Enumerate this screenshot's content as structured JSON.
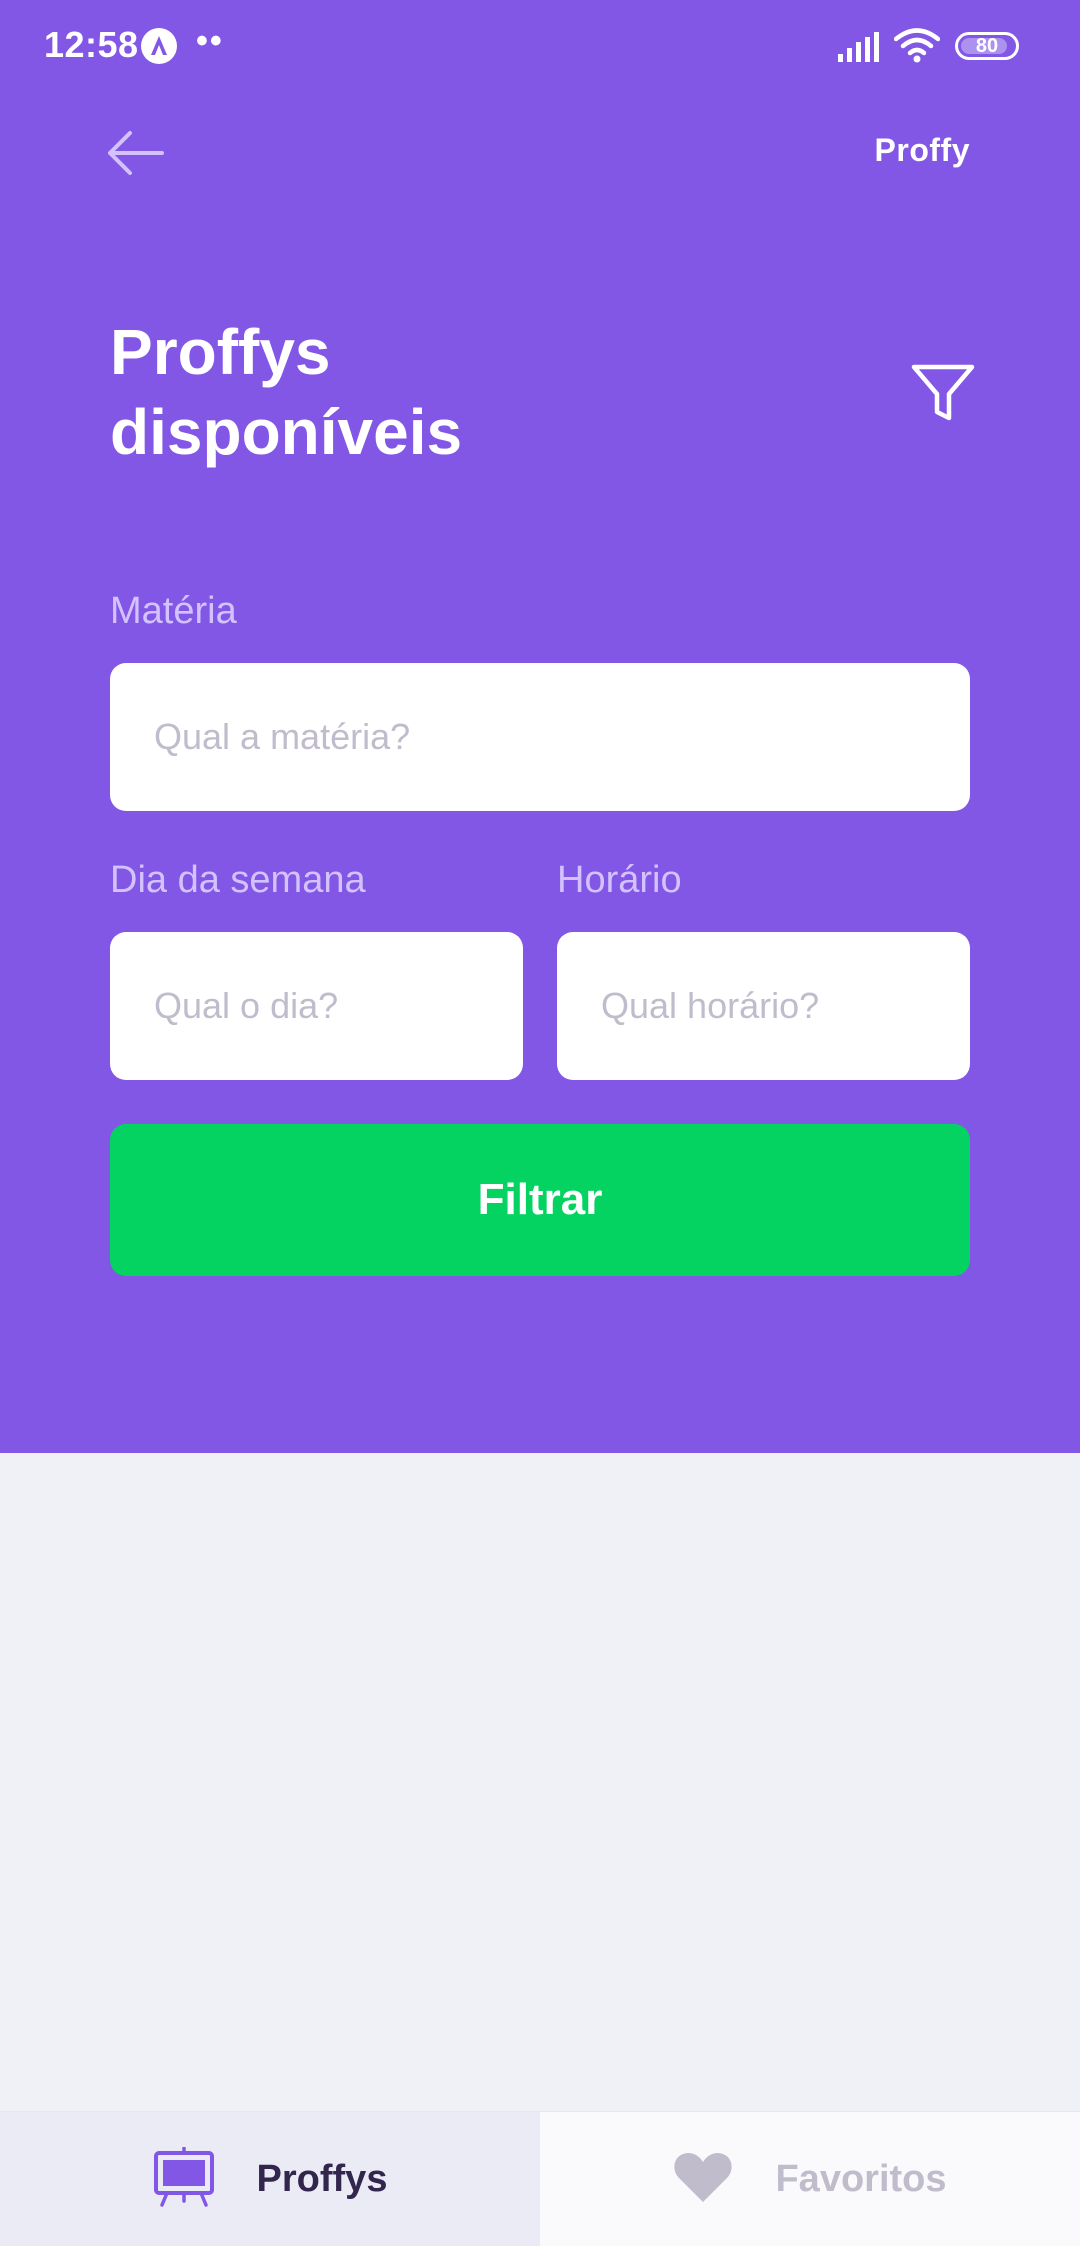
{
  "status_bar": {
    "time": "12:58",
    "notification_dots": "••",
    "battery": "80",
    "icons": [
      "app-notification-icon",
      "signal-icon",
      "wifi-icon",
      "battery-icon"
    ]
  },
  "header": {
    "back_icon": "arrow-left-icon",
    "logo": "Proffy",
    "title": "Proffys disponíveis",
    "filter_icon": "filter-icon"
  },
  "filters": {
    "subject": {
      "label": "Matéria",
      "placeholder": "Qual a matéria?",
      "value": ""
    },
    "week_day": {
      "label": "Dia da semana",
      "placeholder": "Qual o dia?",
      "value": ""
    },
    "time": {
      "label": "Horário",
      "placeholder": "Qual horário?",
      "value": ""
    },
    "submit_label": "Filtrar"
  },
  "tab_bar": {
    "tabs": [
      {
        "label": "Proffys",
        "icon": "easel-icon",
        "active": true
      },
      {
        "label": "Favoritos",
        "icon": "heart-icon",
        "active": false
      }
    ]
  },
  "colors": {
    "primary": "#8257E5",
    "secondary": "#04D361",
    "background": "#F0F0F7",
    "label": "#D4C2FF",
    "placeholder": "#C1BCCC",
    "tab_active_text": "#32264D"
  }
}
